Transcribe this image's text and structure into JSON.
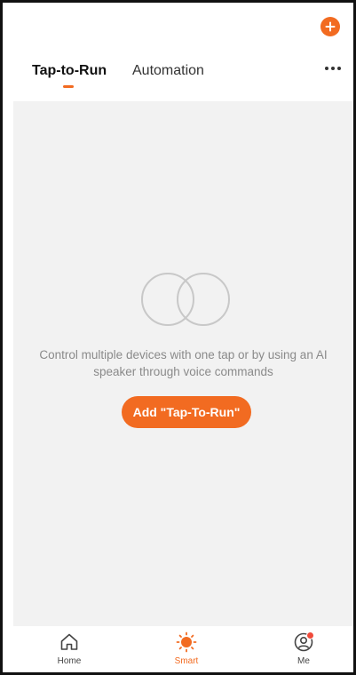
{
  "header": {
    "tabs": [
      {
        "label": "Tap-to-Run",
        "active": true
      },
      {
        "label": "Automation",
        "active": false
      }
    ]
  },
  "empty_state": {
    "message": "Control multiple devices with one tap or by using an AI speaker through voice commands",
    "button_label": "Add \"Tap-To-Run\""
  },
  "bottom_nav": {
    "items": [
      {
        "label": "Home",
        "icon": "home-icon",
        "active": false
      },
      {
        "label": "Smart",
        "icon": "sun-icon",
        "active": true
      },
      {
        "label": "Me",
        "icon": "user-icon",
        "active": false,
        "badge": true
      }
    ]
  },
  "colors": {
    "accent": "#f26b21",
    "background": "#f2f2f2",
    "badge": "#f04a3a"
  }
}
